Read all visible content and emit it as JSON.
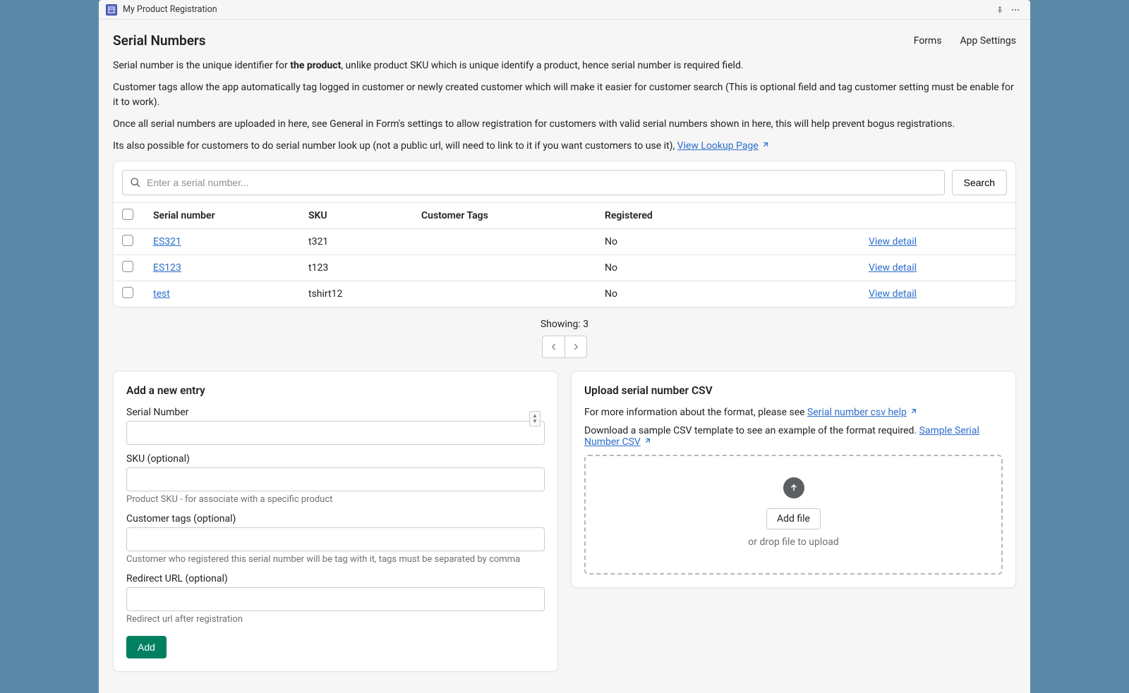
{
  "titleBar": {
    "appName": "My Product Registration"
  },
  "header": {
    "pageTitle": "Serial Numbers",
    "links": {
      "forms": "Forms",
      "appSettings": "App Settings"
    }
  },
  "intro": {
    "p1a": "Serial number is the unique identifier for ",
    "p1bold": "the product",
    "p1b": ", unlike product SKU which is unique identify a product, hence serial number is required field.",
    "p2": "Customer tags allow the app automatically tag logged in customer or newly created customer which will make it easier for customer search (This is optional field and tag customer setting must be enable for it to work).",
    "p3": "Once all serial numbers are uploaded in here, see General in Form's settings to allow registration for customers with valid serial numbers shown in here, this will help prevent bogus registrations.",
    "p4a": "Its also possible for customers to do serial number look up (not a public url, will need to link to it if you want customers to use it), ",
    "p4link": "View Lookup Page"
  },
  "search": {
    "placeholder": "Enter a serial number...",
    "button": "Search"
  },
  "table": {
    "headers": {
      "serial": "Serial number",
      "sku": "SKU",
      "tags": "Customer Tags",
      "registered": "Registered"
    },
    "rows": [
      {
        "serial": "ES321",
        "sku": "t321",
        "tags": "",
        "registered": "No",
        "action": "View detail"
      },
      {
        "serial": "ES123",
        "sku": "t123",
        "tags": "",
        "registered": "No",
        "action": "View detail"
      },
      {
        "serial": "test",
        "sku": "tshirt12",
        "tags": "",
        "registered": "No",
        "action": "View detail"
      }
    ],
    "showing": "Showing: 3"
  },
  "addEntry": {
    "title": "Add a new entry",
    "serialLabel": "Serial Number",
    "skuLabel": "SKU (optional)",
    "skuHelp": "Product SKU - for associate with a specific product",
    "tagsLabel": "Customer tags (optional)",
    "tagsHelp": "Customer who registered this serial number will be tag with it, tags must be separated by comma",
    "redirectLabel": "Redirect URL (optional)",
    "redirectHelp": "Redirect url after registration",
    "addButton": "Add"
  },
  "upload": {
    "title": "Upload serial number CSV",
    "p1a": "For more information about the format, please see ",
    "p1link": "Serial number csv help",
    "p2a": "Download a sample CSV template to see an example of the format required. ",
    "p2link": "Sample Serial Number CSV",
    "addFile": "Add file",
    "dropText": "or drop file to upload"
  }
}
